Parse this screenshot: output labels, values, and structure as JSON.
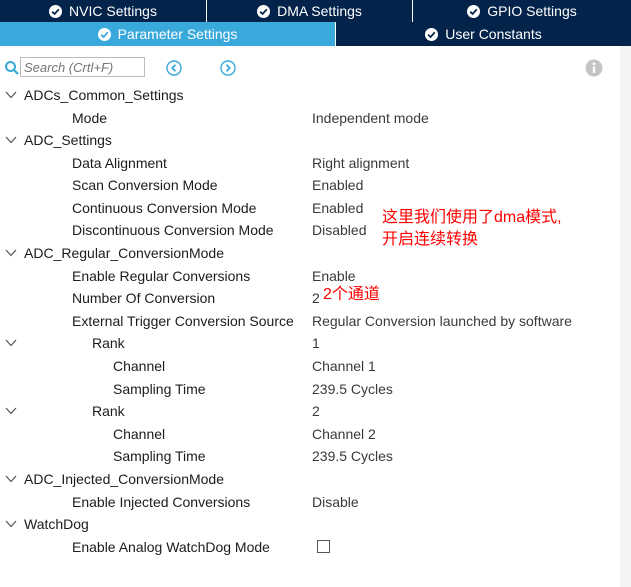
{
  "tabs_top": [
    {
      "label": "NVIC Settings",
      "icon": "check-circle-icon"
    },
    {
      "label": "DMA Settings",
      "icon": "check-circle-icon"
    },
    {
      "label": "GPIO Settings",
      "icon": "check-circle-icon"
    }
  ],
  "tabs_second": [
    {
      "label": "Parameter Settings",
      "icon": "check-circle-icon",
      "active": true
    },
    {
      "label": "User Constants",
      "icon": "check-circle-icon",
      "active": false
    }
  ],
  "search": {
    "placeholder": "Search (Crtl+F)"
  },
  "tree": [
    {
      "level": 0,
      "label": "ADCs_Common_Settings",
      "value": ""
    },
    {
      "level": 1,
      "label": "Mode",
      "value": "Independent mode"
    },
    {
      "level": 0,
      "label": "ADC_Settings",
      "value": ""
    },
    {
      "level": 1,
      "label": "Data Alignment",
      "value": "Right alignment"
    },
    {
      "level": 1,
      "label": "Scan Conversion Mode",
      "value": "Enabled"
    },
    {
      "level": 1,
      "label": "Continuous Conversion Mode",
      "value": "Enabled"
    },
    {
      "level": 1,
      "label": "Discontinuous Conversion Mode",
      "value": "Disabled"
    },
    {
      "level": 0,
      "label": "ADC_Regular_ConversionMode",
      "value": ""
    },
    {
      "level": 1,
      "label": "Enable Regular Conversions",
      "value": "Enable"
    },
    {
      "level": 1,
      "label": "Number Of Conversion",
      "value": "2"
    },
    {
      "level": 1,
      "label": "External Trigger Conversion Source",
      "value": "Regular Conversion launched by software"
    },
    {
      "level": 2,
      "label": "Rank",
      "value": "1"
    },
    {
      "level": 3,
      "label": "Channel",
      "value": "Channel 1"
    },
    {
      "level": 3,
      "label": "Sampling Time",
      "value": "239.5 Cycles"
    },
    {
      "level": 2,
      "label": "Rank",
      "value": "2"
    },
    {
      "level": 3,
      "label": "Channel",
      "value": "Channel 2"
    },
    {
      "level": 3,
      "label": "Sampling Time",
      "value": "239.5 Cycles"
    },
    {
      "level": 0,
      "label": "ADC_Injected_ConversionMode",
      "value": ""
    },
    {
      "level": 1,
      "label": "Enable Injected Conversions",
      "value": "Disable"
    },
    {
      "level": 0,
      "label": "WatchDog",
      "value": ""
    },
    {
      "level": 1,
      "label": "Enable Analog WatchDog Mode",
      "value": "",
      "checkbox": true,
      "checked": false
    }
  ],
  "annotations": {
    "dma_note_line1": "这里我们使用了dma模式,",
    "dma_note_line2": "开启连续转换",
    "channels_note": "2个通道"
  },
  "colors": {
    "tab_dark": "#03234b",
    "tab_active": "#39a9dc",
    "accent_icon": "#39a9dc",
    "annotation": "#ff0000"
  }
}
